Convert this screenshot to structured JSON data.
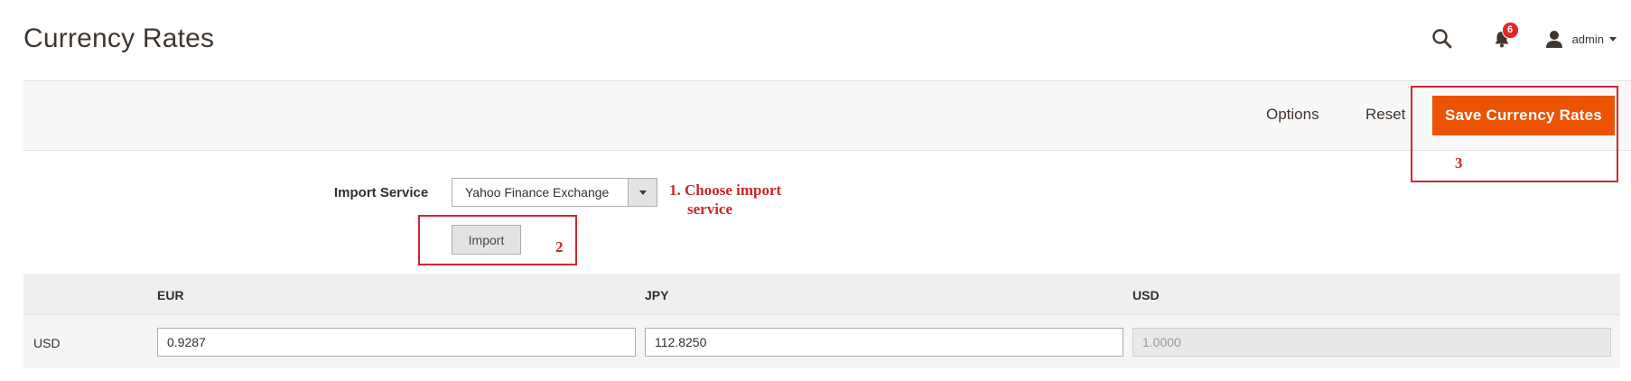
{
  "header": {
    "title": "Currency Rates",
    "notifications_count": "6",
    "user_name": "admin"
  },
  "actions": {
    "options_label": "Options",
    "reset_label": "Reset",
    "save_label": "Save Currency Rates"
  },
  "import": {
    "label": "Import Service",
    "selected_service": "Yahoo Finance Exchange",
    "button_label": "Import"
  },
  "annotations": {
    "step1_line1": "1. Choose import",
    "step1_line2": "service",
    "step2": "2",
    "step3": "3"
  },
  "rates_table": {
    "columns": [
      "EUR",
      "JPY",
      "USD"
    ],
    "rows": [
      {
        "base": "USD",
        "values": [
          "0.9287",
          "112.8250",
          "1.0000"
        ],
        "disabled": [
          false,
          false,
          true
        ]
      }
    ]
  },
  "colors": {
    "accent": "#eb5202",
    "annotation": "#d0272f",
    "notification": "#e22626"
  },
  "icons": [
    "search-icon",
    "bell-icon",
    "user-icon",
    "caret-down-icon",
    "dropdown-arrow-icon"
  ]
}
